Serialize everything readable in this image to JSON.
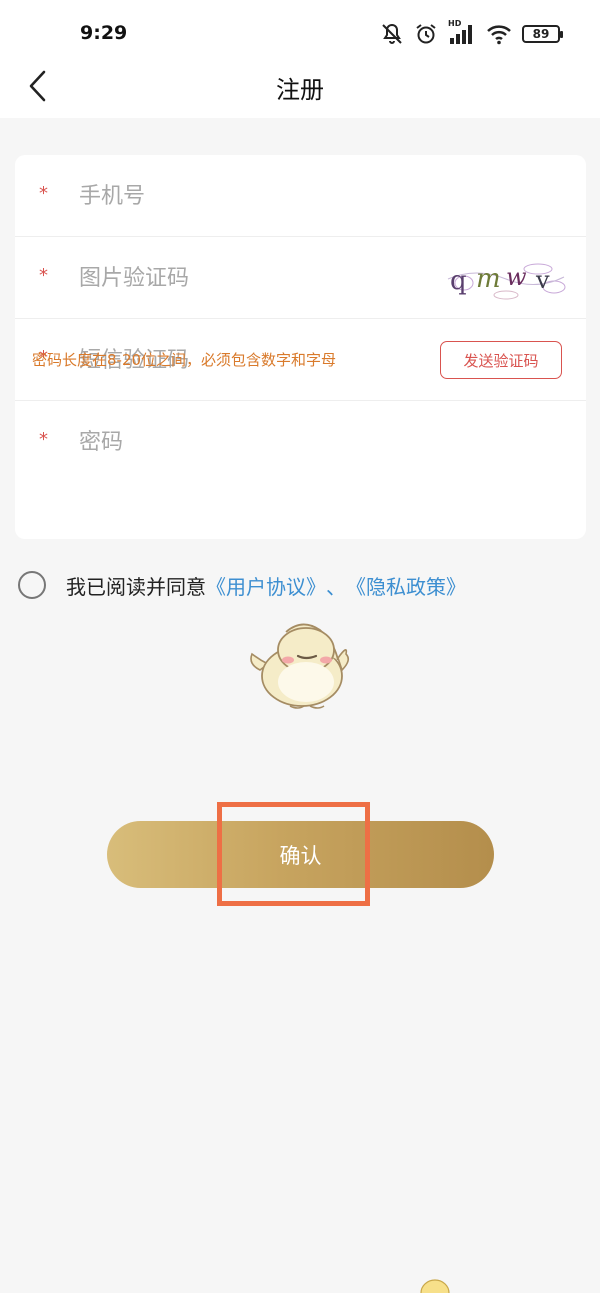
{
  "status_bar": {
    "time": "9:29",
    "battery": "89",
    "network_label": "HD",
    "icons": [
      "mute-icon",
      "alarm-icon",
      "signal-icon",
      "wifi-icon",
      "battery-icon"
    ]
  },
  "nav": {
    "back_icon": "chevron-left-icon",
    "title": "注册"
  },
  "form": {
    "required_mark": "*",
    "phone": {
      "placeholder": "手机号",
      "value": ""
    },
    "captcha": {
      "placeholder": "图片验证码",
      "value": "",
      "code": "qmwv"
    },
    "sms": {
      "placeholder": "短信验证码",
      "value": "",
      "send_label": "发送验证码"
    },
    "password": {
      "placeholder": "密码",
      "value": ""
    },
    "password_hint": "密码长度在8-20位之间，必须包含数字和字母"
  },
  "agreement": {
    "checked": false,
    "prefix": "我已阅读并同意",
    "user_agreement": "《用户协议》",
    "separator": "、",
    "privacy_policy": "《隐私政策》"
  },
  "confirm_label": "确认",
  "colors": {
    "accent_red": "#d9534f",
    "hint_orange": "#d97a2b",
    "link_blue": "#3d8fd1",
    "button_gold_start": "#d8bd7a",
    "button_gold_end": "#b48e4c",
    "highlight_orange": "#ee6f45"
  }
}
